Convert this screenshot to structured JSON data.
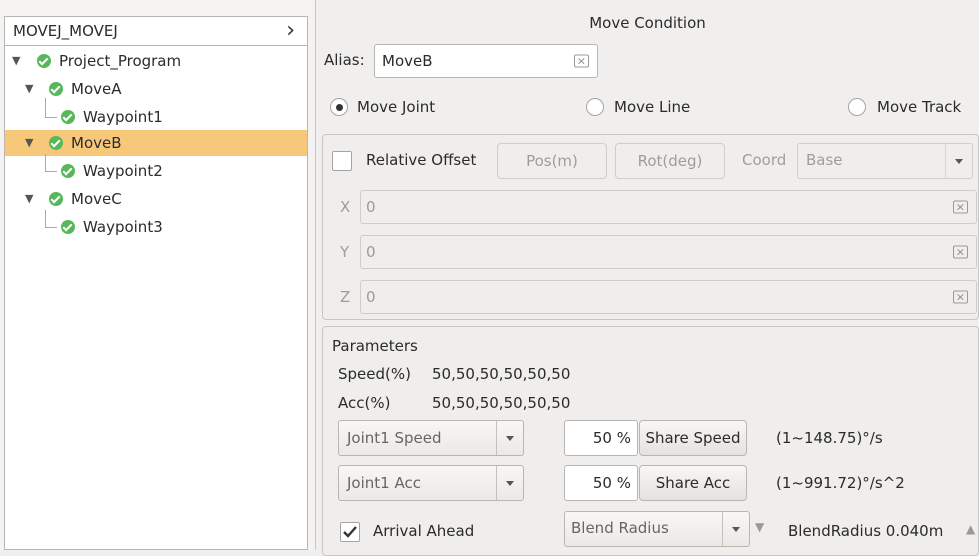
{
  "tree": {
    "header": "MOVEJ_MOVEJ",
    "nodes": [
      {
        "label": "Project_Program"
      },
      {
        "label": "MoveA"
      },
      {
        "label": "Waypoint1"
      },
      {
        "label": "MoveB"
      },
      {
        "label": "Waypoint2"
      },
      {
        "label": "MoveC"
      },
      {
        "label": "Waypoint3"
      }
    ]
  },
  "panel": {
    "title": "Move Condition",
    "alias_label": "Alias:",
    "alias_value": "MoveB",
    "move_modes": [
      {
        "label": "Move Joint",
        "selected": true
      },
      {
        "label": "Move Line",
        "selected": false
      },
      {
        "label": "Move Track",
        "selected": false
      }
    ],
    "offset": {
      "relative_offset_label": "Relative Offset",
      "pos_button": "Pos(m)",
      "rot_button": "Rot(deg)",
      "coord_label": "Coord",
      "coord_value": "Base",
      "x_label": "X",
      "x_value": "0",
      "y_label": "Y",
      "y_value": "0",
      "z_label": "Z",
      "z_value": "0"
    },
    "parameters": {
      "title": "Parameters",
      "speed_label": "Speed(%)",
      "speed_value": "50,50,50,50,50,50",
      "acc_label": "Acc(%)",
      "acc_value": "50,50,50,50,50,50",
      "speed_combo": "Joint1 Speed",
      "speed_percent": "50 %",
      "share_speed_button": "Share Speed",
      "speed_range": "(1~148.75)°/s",
      "acc_combo": "Joint1 Acc",
      "acc_percent": "50 %",
      "share_acc_button": "Share Acc",
      "acc_range": "(1~991.72)°/s^2",
      "arrival_ahead_label": "Arrival Ahead",
      "arrival_ahead_checked": true,
      "blend_combo": "Blend Radius",
      "blend_value": "BlendRadius 0.040m"
    }
  }
}
